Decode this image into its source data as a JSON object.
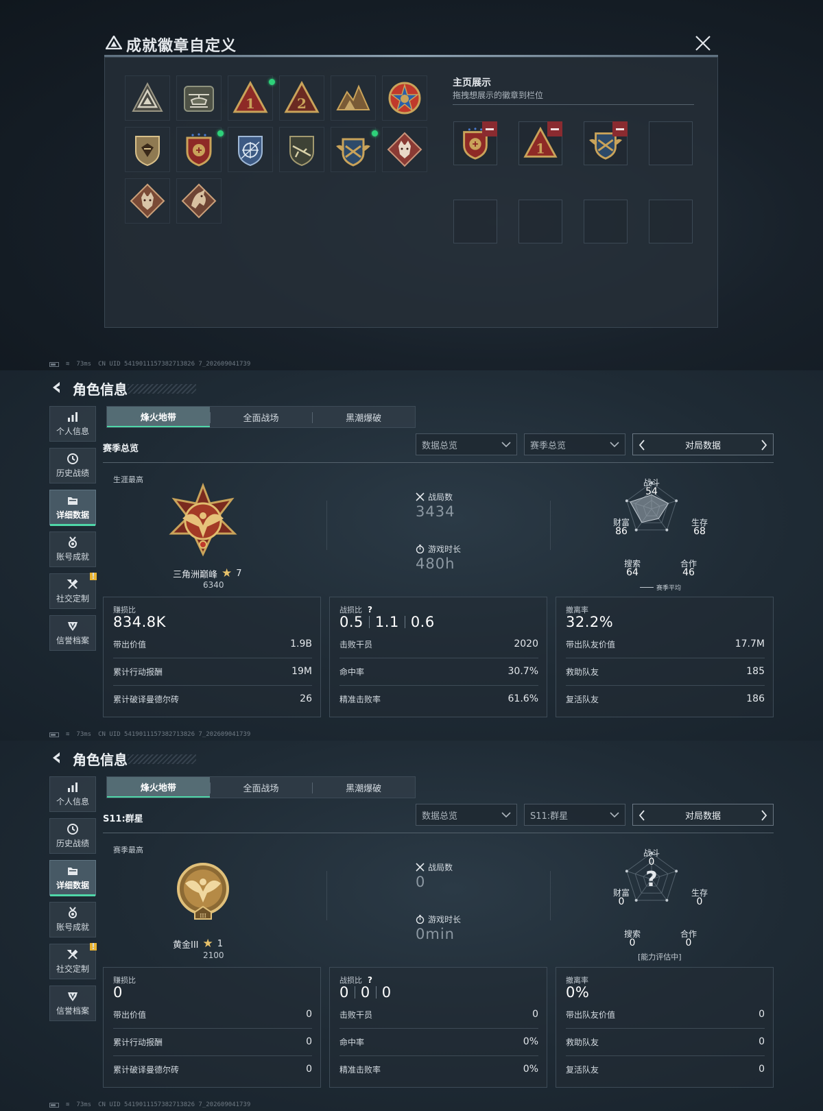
{
  "status_bar": {
    "ping": "73ms",
    "uid": "CN UID 5419011157382713826 7_202609041739"
  },
  "dialog": {
    "title": "成就徽章自定义",
    "display_title": "主页展示",
    "display_hint": "拖拽想展示的徽章到栏位",
    "badges": [
      {
        "icon": "delta-triangle-badge",
        "new": false
      },
      {
        "icon": "helicopter-badge",
        "new": false
      },
      {
        "icon": "number-1-triangle-badge",
        "new": true
      },
      {
        "icon": "number-2-triangle-badge",
        "new": false
      },
      {
        "icon": "mountain-peak-badge",
        "new": false
      },
      {
        "icon": "star-medal-badge",
        "new": false
      },
      {
        "icon": "bronze-shield-badge",
        "new": false
      },
      {
        "icon": "red-shield-badge",
        "new": true
      },
      {
        "icon": "blue-sniper-shield-badge",
        "new": false
      },
      {
        "icon": "rifle-shield-badge",
        "new": false
      },
      {
        "icon": "gold-wings-shield-badge",
        "new": true
      },
      {
        "icon": "wolf-diamond-badge",
        "new": false
      },
      {
        "icon": "wolf-diamond-bronze-badge",
        "new": false
      },
      {
        "icon": "dragon-diamond-badge",
        "new": false
      }
    ],
    "display_slots": [
      {
        "icon": "red-shield-badge",
        "filled": true
      },
      {
        "icon": "number-1-triangle-badge",
        "filled": true
      },
      {
        "icon": "gold-wings-shield-badge",
        "filled": true
      },
      {
        "filled": false
      },
      {
        "filled": false
      },
      {
        "filled": false
      },
      {
        "filled": false
      },
      {
        "filled": false
      }
    ]
  },
  "pages": [
    {
      "title": "角色信息",
      "nav": [
        {
          "label": "个人信息",
          "icon": "bar-chart-icon",
          "active": false,
          "notice": false
        },
        {
          "label": "历史战绩",
          "icon": "clock-icon",
          "active": false,
          "notice": false
        },
        {
          "label": "详细数据",
          "icon": "folder-icon",
          "active": true,
          "notice": false
        },
        {
          "label": "账号成就",
          "icon": "medal-icon",
          "active": false,
          "notice": false
        },
        {
          "label": "社交定制",
          "icon": "tools-icon",
          "active": false,
          "notice": true
        },
        {
          "label": "信誉档案",
          "icon": "shield-v-icon",
          "active": false,
          "notice": false
        }
      ],
      "notice_mark": "!",
      "tabs": [
        "烽火地带",
        "全面战场",
        "黑潮爆破"
      ],
      "active_tab": 0,
      "section": "赛季总览",
      "select1": "数据总览",
      "select2": "赛季总览",
      "match_btn": "对局数据",
      "best_label": "生涯最高",
      "rank_name": "三角洲巅峰",
      "rank_stars": "7",
      "rank_score": "6340",
      "emblem": "winged-star-medal",
      "matches_label": "战局数",
      "matches": "3434",
      "time_label": "游戏时长",
      "time": "480h",
      "radar": {
        "unknown": false,
        "labels": {
          "combat": "战斗",
          "survive": "生存",
          "coop": "合作",
          "search": "搜索",
          "wealth": "财富"
        },
        "values": {
          "combat": "54",
          "survive": "68",
          "coop": "46",
          "search": "64",
          "wealth": "86"
        },
        "note": "赛季平均"
      },
      "cards": [
        {
          "title": "赚损比",
          "big": [
            "834.8K"
          ],
          "q": false,
          "rows": [
            {
              "label": "带出价值",
              "value": "1.9B"
            },
            {
              "label": "累计行动报酬",
              "value": "19M"
            },
            {
              "label": "累计破译曼德尔砖",
              "value": "26"
            }
          ]
        },
        {
          "title": "战损比",
          "big": [
            "0.5",
            "1.1",
            "0.6"
          ],
          "q": true,
          "rows": [
            {
              "label": "击败干员",
              "value": "2020"
            },
            {
              "label": "命中率",
              "value": "30.7%"
            },
            {
              "label": "精准击败率",
              "value": "61.6%"
            }
          ]
        },
        {
          "title": "撤离率",
          "big": [
            "32.2%"
          ],
          "q": false,
          "rows": [
            {
              "label": "带出队友价值",
              "value": "17.7M"
            },
            {
              "label": "救助队友",
              "value": "185"
            },
            {
              "label": "复活队友",
              "value": "186"
            }
          ]
        }
      ]
    },
    {
      "title": "角色信息",
      "nav": [
        {
          "label": "个人信息",
          "icon": "bar-chart-icon",
          "active": false,
          "notice": false
        },
        {
          "label": "历史战绩",
          "icon": "clock-icon",
          "active": false,
          "notice": false
        },
        {
          "label": "详细数据",
          "icon": "folder-icon",
          "active": true,
          "notice": false
        },
        {
          "label": "账号成就",
          "icon": "medal-icon",
          "active": false,
          "notice": false
        },
        {
          "label": "社交定制",
          "icon": "tools-icon",
          "active": false,
          "notice": true
        },
        {
          "label": "信誉档案",
          "icon": "shield-v-icon",
          "active": false,
          "notice": false
        }
      ],
      "notice_mark": "!",
      "tabs": [
        "烽火地带",
        "全面战场",
        "黑潮爆破"
      ],
      "active_tab": 0,
      "section": "S11:群星",
      "select1": "数据总览",
      "select2": "S11:群星",
      "match_btn": "对局数据",
      "best_label": "赛季最高",
      "rank_name": "黄金III",
      "rank_stars": "1",
      "rank_score": "2100",
      "emblem": "gold-eagle-coin",
      "matches_label": "战局数",
      "matches": "0",
      "time_label": "游戏时长",
      "time": "0min",
      "radar": {
        "unknown": true,
        "unknown_mark": "?",
        "labels": {
          "combat": "战斗",
          "survive": "生存",
          "coop": "合作",
          "search": "搜索",
          "wealth": "财富"
        },
        "values": {
          "combat": "0",
          "survive": "0",
          "coop": "0",
          "search": "0",
          "wealth": "0"
        },
        "note": "[能力评估中]"
      },
      "cards": [
        {
          "title": "赚损比",
          "big": [
            "0"
          ],
          "q": false,
          "rows": [
            {
              "label": "带出价值",
              "value": "0"
            },
            {
              "label": "累计行动报酬",
              "value": "0"
            },
            {
              "label": "累计破译曼德尔砖",
              "value": "0"
            }
          ]
        },
        {
          "title": "战损比",
          "big": [
            "0",
            "0",
            "0"
          ],
          "q": true,
          "rows": [
            {
              "label": "击败干员",
              "value": "0"
            },
            {
              "label": "命中率",
              "value": "0%"
            },
            {
              "label": "精准击败率",
              "value": "0%"
            }
          ]
        },
        {
          "title": "撤离率",
          "big": [
            "0%"
          ],
          "q": false,
          "rows": [
            {
              "label": "带出队友价值",
              "value": "0"
            },
            {
              "label": "救助队友",
              "value": "0"
            },
            {
              "label": "复活队友",
              "value": "0"
            }
          ]
        }
      ]
    }
  ]
}
